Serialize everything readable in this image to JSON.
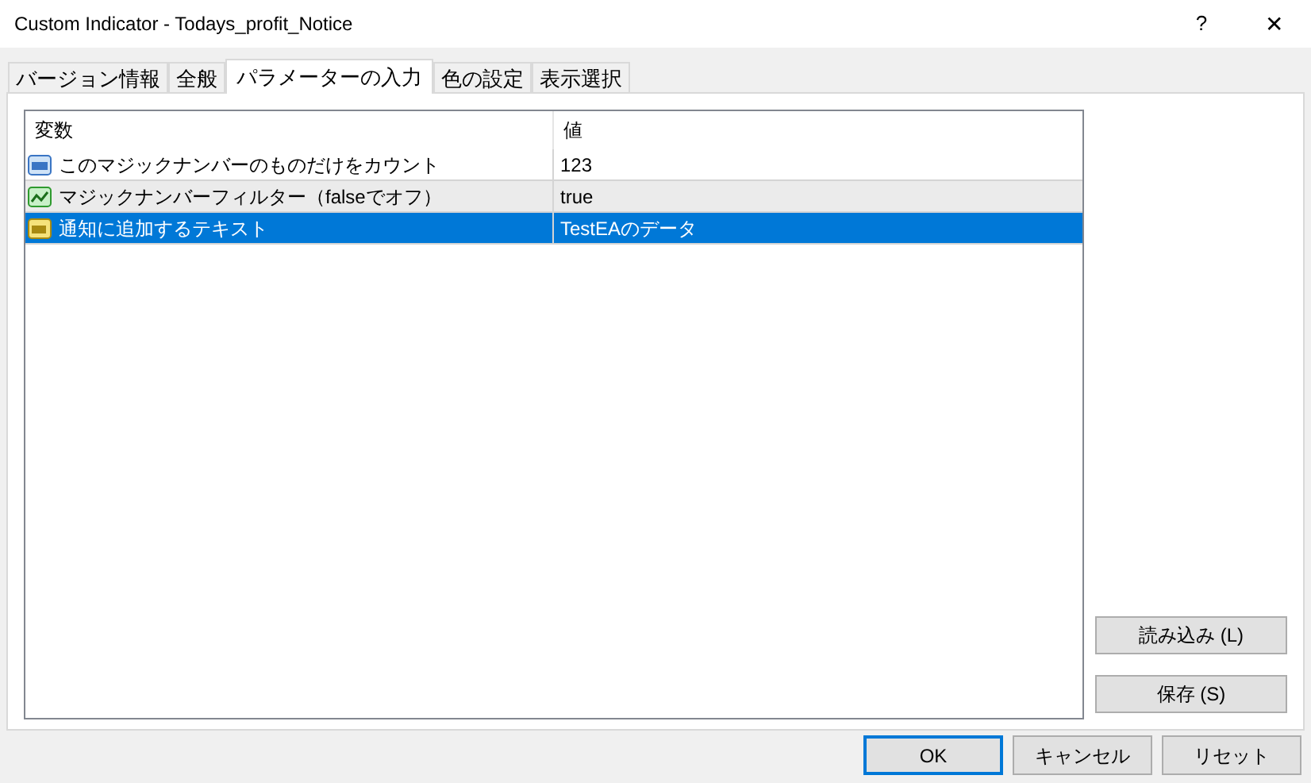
{
  "window": {
    "title": "Custom Indicator - Todays_profit_Notice",
    "help": "?",
    "close": "✕"
  },
  "tabs": [
    {
      "label": "バージョン情報",
      "selected": false
    },
    {
      "label": "全般",
      "selected": false
    },
    {
      "label": "パラメーターの入力",
      "selected": true
    },
    {
      "label": "色の設定",
      "selected": false
    },
    {
      "label": "表示選択",
      "selected": false
    }
  ],
  "table": {
    "columns": [
      "変数",
      "値"
    ],
    "rows": [
      {
        "kind": "int",
        "name": "このマジックナンバーのものだけをカウント",
        "value": "123",
        "hovered": false,
        "selected": false
      },
      {
        "kind": "bool",
        "name": "マジックナンバーフィルター（falseでオフ）",
        "value": "true",
        "hovered": true,
        "selected": false
      },
      {
        "kind": "string",
        "name": "通知に追加するテキスト",
        "value": "TestEAのデータ",
        "hovered": false,
        "selected": true
      }
    ]
  },
  "side_buttons": [
    "読み込み (L)",
    "保存 (S)"
  ],
  "buttons": [
    {
      "label": "OK",
      "default": true
    },
    {
      "label": "キャンセル",
      "default": false
    },
    {
      "label": "リセット",
      "default": false
    }
  ]
}
